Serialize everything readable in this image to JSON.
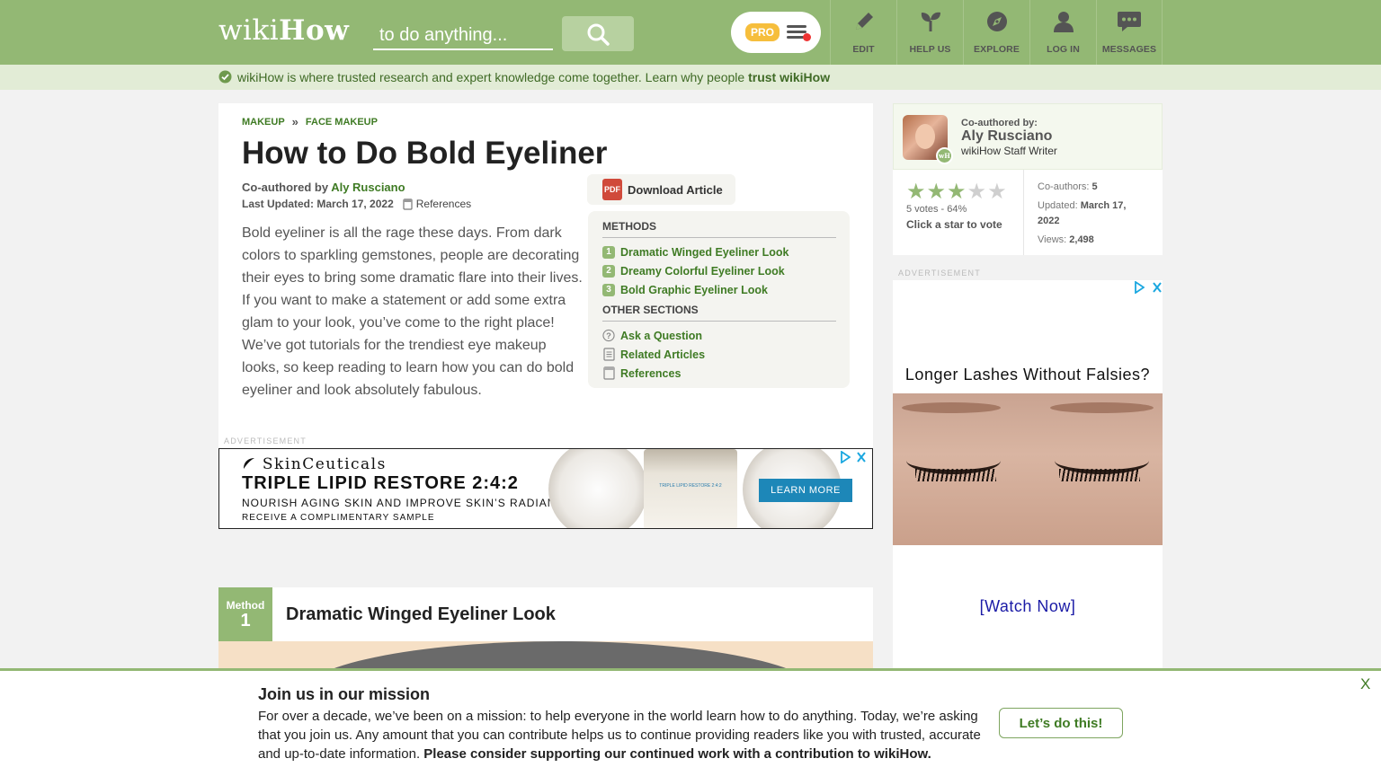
{
  "header": {
    "logo_light": "wiki",
    "logo_bold": "How",
    "search_placeholder": "to do anything...",
    "pro_label": "PRO",
    "nav": [
      "EDIT",
      "HELP US",
      "EXPLORE",
      "LOG IN",
      "MESSAGES"
    ],
    "bg_color": "#93b874"
  },
  "trustbar": {
    "text": "wikiHow is where trusted research and expert knowledge come together. Learn why people ",
    "link": "trust wikiHow"
  },
  "article": {
    "breadcrumb": [
      "MAKEUP",
      "FACE MAKEUP"
    ],
    "breadcrumb_sep": "»",
    "title": "How to Do Bold Eyeliner",
    "coauthored_prefix": "Co-authored by ",
    "author": "Aly Rusciano",
    "last_updated_label": "Last Updated:",
    "last_updated": "March 17, 2022",
    "references_label": "References",
    "intro": "Bold eyeliner is all the rage these days. From dark colors to sparkling gemstones, people are decorating their eyes to bring some dramatic flare into their lives. If you want to make a statement or add some extra glam to your look, you’ve come to the right place! We’ve got tutorials for the trendiest eye makeup looks, so keep reading to learn how you can do bold eyeliner and look absolutely fabulous.",
    "download_label": "Download Article",
    "pdf_icon_text": "PDF"
  },
  "toc": {
    "methods_heading": "METHODS",
    "methods": [
      {
        "num": "1",
        "label": "Dramatic Winged Eyeliner Look"
      },
      {
        "num": "2",
        "label": "Dreamy Colorful Eyeliner Look"
      },
      {
        "num": "3",
        "label": "Bold Graphic Eyeliner Look"
      }
    ],
    "other_heading": "OTHER SECTIONS",
    "other": [
      {
        "icon": "question-icon",
        "label": "Ask a Question"
      },
      {
        "icon": "document-icon",
        "label": "Related Articles"
      },
      {
        "icon": "bookmark-icon",
        "label": "References"
      }
    ]
  },
  "ad_banner": {
    "label": "ADVERTISEMENT",
    "brand": "SkinCeuticals",
    "headline": "TRIPLE LIPID RESTORE 2:4:2",
    "sub": "NOURISH AGING SKIN AND IMPROVE SKIN’S RADIANCE",
    "sub2": "RECEIVE A COMPLIMENTARY SAMPLE",
    "product_label": "TRIPLE LIPID RESTORE 2:4:2",
    "cta": "LEARN MORE"
  },
  "method": {
    "label": "Method",
    "number": "1",
    "title": "Dramatic Winged Eyeliner Look"
  },
  "sidebar": {
    "coauthored_label": "Co-authored by:",
    "author_name": "Aly Rusciano",
    "author_role": "wikiHow Staff Writer",
    "badge_text": "wH",
    "rating_stars": 3,
    "rating_max": 5,
    "votes_text": "5 votes - 64%",
    "vote_cta": "Click a star to vote",
    "coauthors_label": "Co-authors:",
    "coauthors_value": "5",
    "updated_label": "Updated:",
    "updated_value": "March 17, 2022",
    "views_label": "Views:",
    "views_value": "2,498"
  },
  "side_ad": {
    "label": "ADVERTISEMENT",
    "headline": "Longer Lashes Without Falsies?",
    "cta": "[Watch Now]"
  },
  "mission": {
    "title": "Join us in our mission",
    "body": "For over a decade, we’ve been on a mission: to help everyone in the world learn how to do anything. Today, we’re asking that you join us. Any amount that you can contribute helps us to continue providing readers like you with trusted, accurate and up-to-date information. ",
    "body_bold": "Please consider supporting our continued work with a contribution to wikiHow.",
    "button": "Let’s do this!",
    "close": "X"
  }
}
